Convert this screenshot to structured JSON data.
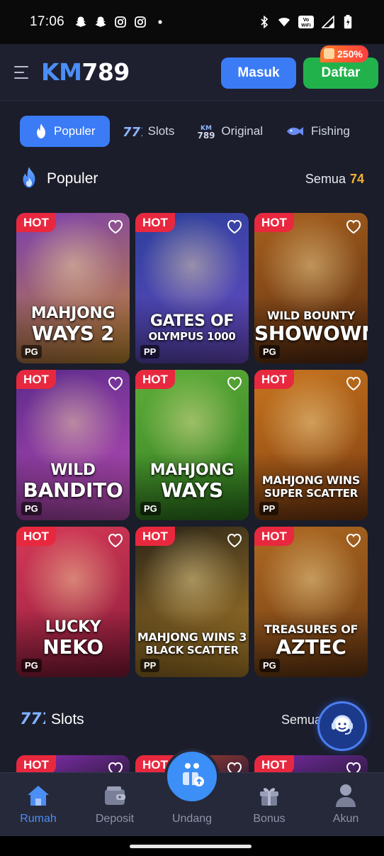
{
  "status_bar": {
    "time": "17:06",
    "left_icons": [
      "snapchat-icon",
      "snapchat-icon",
      "instagram-icon",
      "instagram-icon",
      "dot-icon"
    ],
    "right_icons": [
      "bluetooth-icon",
      "wifi-icon",
      "vowifi-icon",
      "signal-icon",
      "battery-icon"
    ],
    "vowifi_text": "Vo WiFi"
  },
  "header": {
    "logo_km": "KM",
    "logo_num": "789",
    "login_label": "Masuk",
    "register_label": "Daftar",
    "bonus_label": "250%"
  },
  "tabs": [
    {
      "label": "Populer",
      "icon": "fire-icon",
      "active": true
    },
    {
      "label": "Slots",
      "icon": "slots-777-icon",
      "active": false
    },
    {
      "label": "Original",
      "icon": "km789-icon",
      "icon_text": "KM 789",
      "active": false
    },
    {
      "label": "Fishing",
      "icon": "fish-icon",
      "active": false
    }
  ],
  "popular_section": {
    "title": "Populer",
    "all_label": "Semua",
    "count": "74"
  },
  "games": [
    {
      "hot": "HOT",
      "line1": "MAHJONG",
      "line2": "WAYS 2",
      "provider": "PG",
      "c1": "#7b3fb0",
      "c2": "#c58a2e"
    },
    {
      "hot": "HOT",
      "line1": "GATES OF",
      "line2": "OLYMPUS 1000",
      "provider": "PP",
      "c1": "#2a3f9a",
      "c2": "#6b4cc8"
    },
    {
      "hot": "HOT",
      "line1": "WILD BOUNTY",
      "line2": "SHOWOWN",
      "provider": "PG",
      "c1": "#a8611f",
      "c2": "#5a2c10"
    },
    {
      "hot": "HOT",
      "line1": "WILD",
      "line2": "BANDITO",
      "provider": "PG",
      "c1": "#5b2a8c",
      "c2": "#c04fb8"
    },
    {
      "hot": "HOT",
      "line1": "MAHJONG",
      "line2": "WAYS",
      "provider": "PG",
      "c1": "#5fae3a",
      "c2": "#2e7a1e"
    },
    {
      "hot": "HOT",
      "line1": "MAHJONG WINS",
      "line2": "SUPER SCATTER",
      "provider": "PP",
      "c1": "#c8751e",
      "c2": "#7a3a10"
    },
    {
      "hot": "HOT",
      "line1": "LUCKY",
      "line2": "NEKO",
      "provider": "PG",
      "c1": "#d63a58",
      "c2": "#8a1a3a"
    },
    {
      "hot": "HOT",
      "line1": "MAHJONG WINS 3",
      "line2": "BLACK SCATTER",
      "provider": "PP",
      "c1": "#2a2418",
      "c2": "#b5842a"
    },
    {
      "hot": "HOT",
      "line1": "TREASURES OF",
      "line2": "AZTEC",
      "provider": "PG",
      "c1": "#b06a22",
      "c2": "#6a3812"
    }
  ],
  "slots_section": {
    "title": "Slots",
    "all_label": "Semua"
  },
  "slots_preview": [
    {
      "hot": "HOT",
      "c1": "#8a2fb8"
    },
    {
      "hot": "HOT",
      "c1": "#b8452a"
    },
    {
      "hot": "HOT",
      "c1": "#7a2aa8"
    }
  ],
  "bottom_nav": [
    {
      "label": "Rumah",
      "icon": "home-icon",
      "active": true
    },
    {
      "label": "Deposit",
      "icon": "wallet-icon",
      "active": false
    },
    {
      "label": "Undang",
      "icon": "invite-icon",
      "active": false
    },
    {
      "label": "Bonus",
      "icon": "gift-icon",
      "active": false
    },
    {
      "label": "Akun",
      "icon": "user-icon",
      "active": false
    }
  ],
  "support_icon": "headset-icon",
  "colors": {
    "primary": "#3b7bf5",
    "success": "#22b24c",
    "hot": "#e8283e",
    "background": "#1b1d2a",
    "accent_count": "#f2b233"
  }
}
